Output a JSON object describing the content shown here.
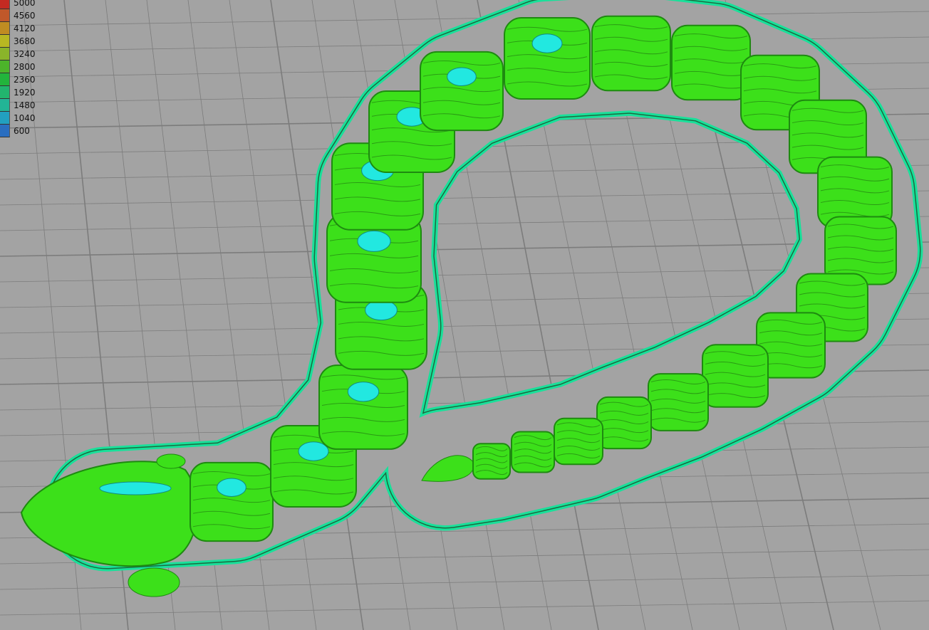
{
  "legend": {
    "items": [
      {
        "label": "5000",
        "color": "#c42a22"
      },
      {
        "label": "4560",
        "color": "#c0582a"
      },
      {
        "label": "4120",
        "color": "#c08c22"
      },
      {
        "label": "3680",
        "color": "#b8b822"
      },
      {
        "label": "3240",
        "color": "#8ab42a"
      },
      {
        "label": "2800",
        "color": "#4cb42a"
      },
      {
        "label": "2360",
        "color": "#22b43c"
      },
      {
        "label": "1920",
        "color": "#22b46e"
      },
      {
        "label": "1480",
        "color": "#22b496"
      },
      {
        "label": "1040",
        "color": "#22a0c0"
      },
      {
        "label": "600",
        "color": "#2a6ec0"
      }
    ]
  },
  "colors": {
    "model": "#3ce01a",
    "skirt": "#19e09a",
    "highlight": "#22e8e0",
    "bed": "#a3a3a3",
    "grid": "#7c7c7c"
  }
}
